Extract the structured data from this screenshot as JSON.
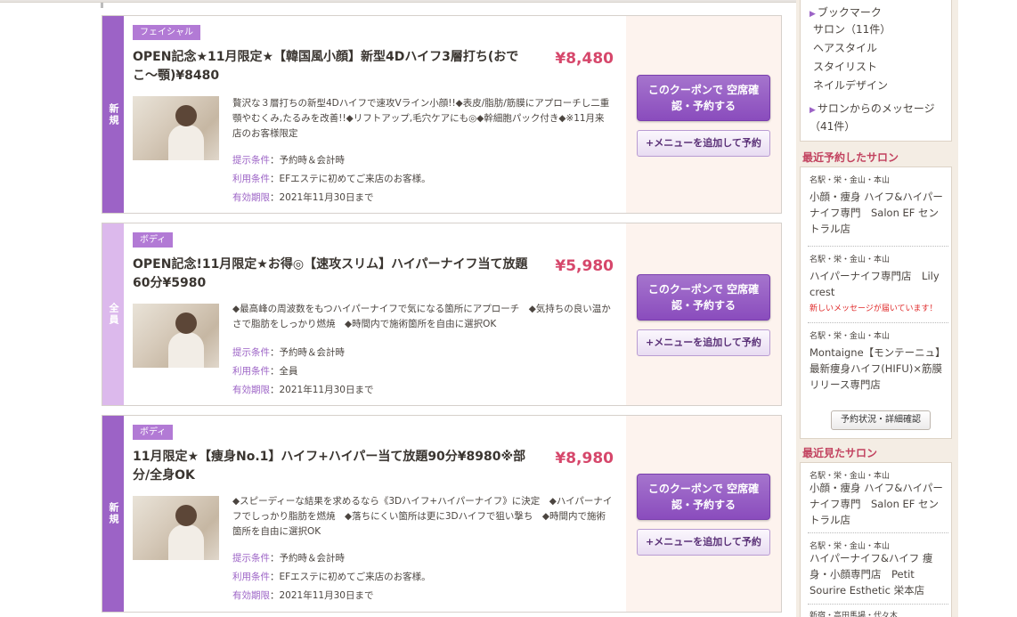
{
  "coupons": [
    {
      "tag": "新規",
      "category": "フェイシャル",
      "title": "OPEN記念★11月限定★【韓国風小顔】新型4Dハイフ3層打ち(おでこ〜顎)¥8480",
      "price": "¥8,480",
      "description": "贅沢な３層打ちの新型4Dハイフで速攻Vライン小顔!!◆表皮/脂肪/筋膜にアプローチし二重顎やむくみ,たるみを改善!!◆リフトアップ,毛穴ケアにも◎◆幹細胞パック付き◆※11月来店のお客様限定",
      "conditions": [
        {
          "label": "提示条件",
          "value": "予約時＆会計時"
        },
        {
          "label": "利用条件",
          "value": "EFエステに初めてご来店のお客様。"
        },
        {
          "label": "有効期限",
          "value": "2021年11月30日まで"
        }
      ],
      "reserve_label": "このクーポンで 空席確認・予約する",
      "menu_label": "+メニューを追加して予約"
    },
    {
      "tag": "全員",
      "category": "ボディ",
      "title": "OPEN記念!11月限定★お得◎【速攻スリム】ハイパーナイフ当て放題60分¥5980",
      "price": "¥5,980",
      "description": "◆最高峰の周波数をもつハイパーナイフで気になる箇所にアプローチ　◆気持ちの良い温かさで脂肪をしっかり燃焼　◆時間内で施術箇所を自由に選択OK",
      "conditions": [
        {
          "label": "提示条件",
          "value": "予約時＆会計時"
        },
        {
          "label": "利用条件",
          "value": "全員"
        },
        {
          "label": "有効期限",
          "value": "2021年11月30日まで"
        }
      ],
      "reserve_label": "このクーポンで 空席確認・予約する",
      "menu_label": "+メニューを追加して予約"
    },
    {
      "tag": "新規",
      "category": "ボディ",
      "title": "11月限定★【痩身No.1】ハイフ+ハイパー当て放題90分¥8980※部分/全身OK",
      "price": "¥8,980",
      "description": "◆スピーディーな結果を求めるなら《3Dハイフ+ハイパーナイフ》に決定　◆ハイパーナイフでしっかり脂肪を燃焼　◆落ちにくい箇所は更に3Dハイフで狙い撃ち　◆時間内で施術箇所を自由に選択OK",
      "conditions": [
        {
          "label": "提示条件",
          "value": "予約時＆会計時"
        },
        {
          "label": "利用条件",
          "value": "EFエステに初めてご来店のお客様。"
        },
        {
          "label": "有効期限",
          "value": "2021年11月30日まで"
        }
      ],
      "reserve_label": "このクーポンで 空席確認・予約する",
      "menu_label": "+メニューを追加して予約"
    }
  ],
  "sidebar": {
    "bookmark": {
      "title": "ブックマーク",
      "items": [
        "サロン（11件）",
        "ヘアスタイル",
        "スタイリスト",
        "ネイルデザイン"
      ],
      "messages": "サロンからのメッセージ（41件）"
    },
    "recent_reserved": {
      "heading": "最近予約したサロン",
      "salons": [
        {
          "area": "名駅・栄・金山・本山",
          "name": "小顔・痩身 ハイフ&ハイパーナイフ専門　Salon EF セントラル店"
        },
        {
          "area": "名駅・栄・金山・本山",
          "name": "ハイパーナイフ専門店　Lily crest",
          "message": "新しいメッセージが届いています！"
        },
        {
          "area": "名駅・栄・金山・本山",
          "name": "Montaigne【モンテーニュ】最新痩身ハイフ(HIFU)×筋膜リリース専門店"
        }
      ],
      "status_button": "予約状況・詳細確認"
    },
    "recent_viewed": {
      "heading": "最近見たサロン",
      "salons": [
        {
          "area": "名駅・栄・金山・本山",
          "name": "小顔・痩身 ハイフ&ハイパーナイフ専門　Salon EF セントラル店"
        },
        {
          "area": "名駅・栄・金山・本山",
          "name": "ハイパーナイフ&ハイフ 痩身・小顔専門店　Petit Sourire Esthetic 栄本店"
        },
        {
          "area": "新宿・高田馬場・代々木"
        }
      ]
    }
  },
  "colors": {
    "accent_purple": "#9c63c6",
    "price_pink": "#d6476b",
    "heading_red": "#c2425f"
  }
}
